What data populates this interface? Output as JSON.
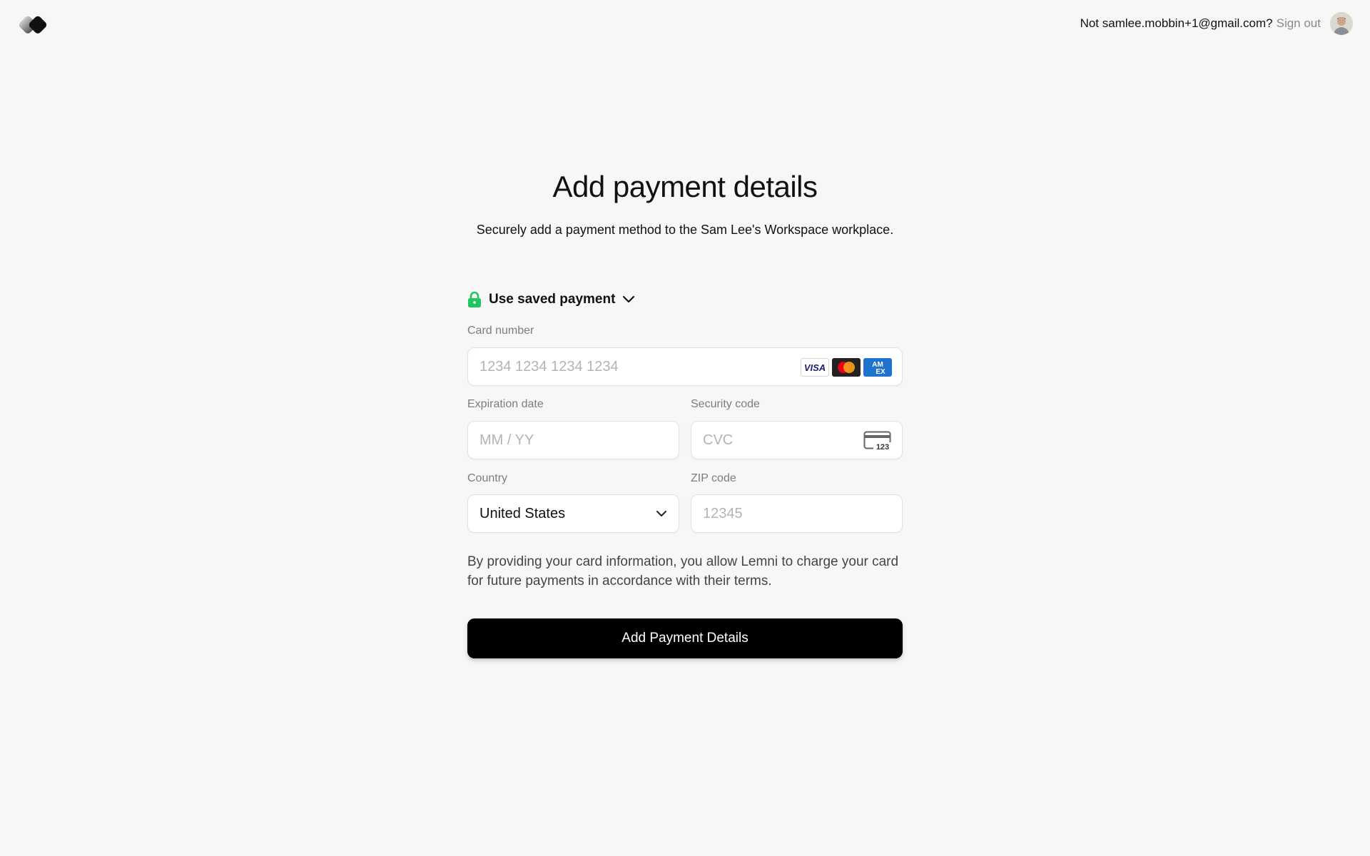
{
  "header": {
    "not_text": "Not samlee.mobbin+1@gmail.com?",
    "signout_label": "Sign out",
    "logo_icon": "diamond-logo-icon",
    "avatar_icon": "user-avatar"
  },
  "page": {
    "title": "Add payment details",
    "subtitle": "Securely add a payment method to the Sam Lee's Workspace workplace."
  },
  "saved_payment": {
    "label": "Use saved payment",
    "lock_icon": "lock-icon",
    "chevron_icon": "chevron-down-icon",
    "accent_color": "#22c55e"
  },
  "form": {
    "card_number": {
      "label": "Card number",
      "placeholder": "1234 1234 1234 1234",
      "brands": [
        "VISA",
        "Mastercard",
        "AMEX"
      ]
    },
    "expiration": {
      "label": "Expiration date",
      "placeholder": "MM / YY"
    },
    "security_code": {
      "label": "Security code",
      "placeholder": "CVC",
      "icon_text": "123"
    },
    "country": {
      "label": "Country",
      "value": "United States"
    },
    "zip": {
      "label": "ZIP code",
      "placeholder": "12345"
    }
  },
  "notice": "By providing your card information, you allow Lemni to charge your card for future payments in accordance with their terms.",
  "submit_label": "Add Payment Details"
}
